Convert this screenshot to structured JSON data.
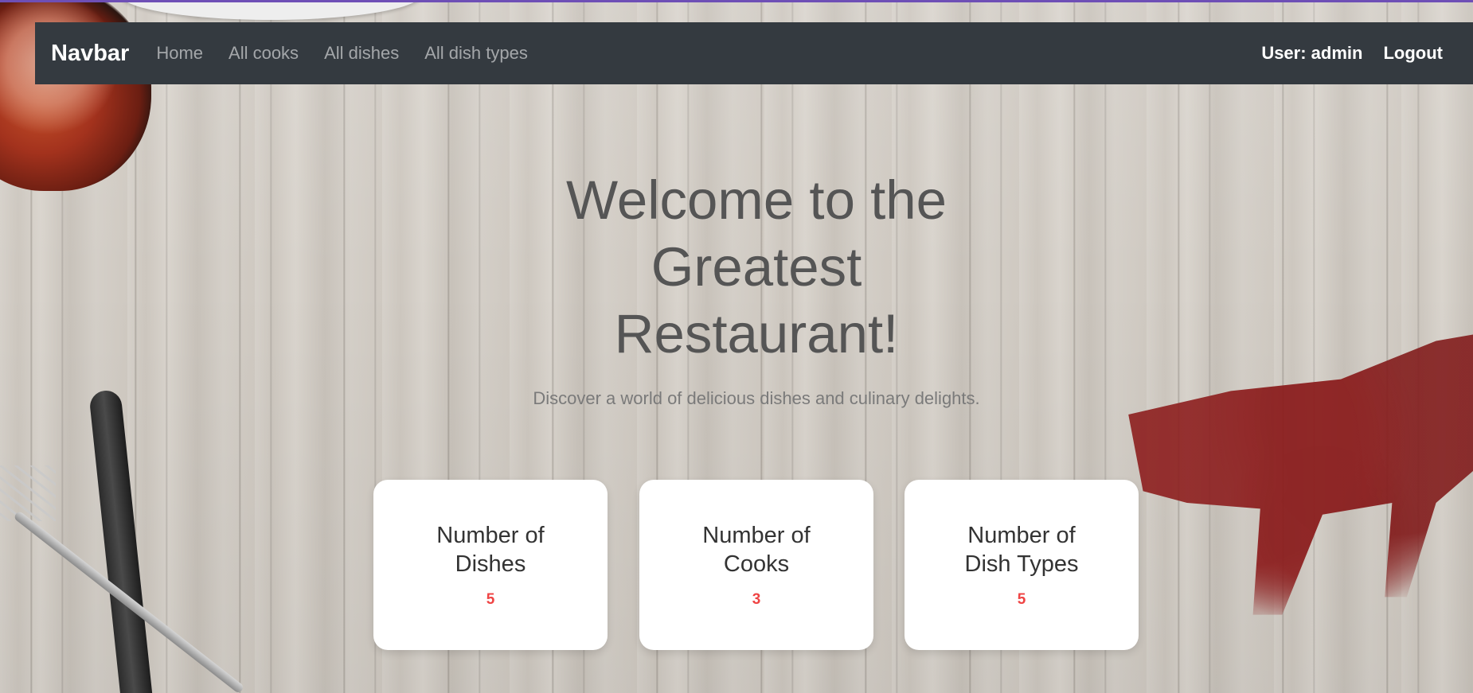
{
  "navbar": {
    "brand": "Navbar",
    "links": [
      "Home",
      "All cooks",
      "All dishes",
      "All dish types"
    ],
    "user_label": "User: admin",
    "logout_label": "Logout"
  },
  "hero": {
    "title_line1": "Welcome to the",
    "title_line2": "Greatest",
    "title_line3": "Restaurant!",
    "subtitle": "Discover a world of delicious dishes and culinary delights."
  },
  "cards": [
    {
      "title_line1": "Number of",
      "title_line2": "Dishes",
      "count": "5"
    },
    {
      "title_line1": "Number of",
      "title_line2": "Cooks",
      "count": "3"
    },
    {
      "title_line1": "Number of",
      "title_line2": "Dish Types",
      "count": "5"
    }
  ],
  "colors": {
    "navbar_bg": "#343a40",
    "accent_count": "#ef4444",
    "top_line": "#6e4fb6"
  }
}
